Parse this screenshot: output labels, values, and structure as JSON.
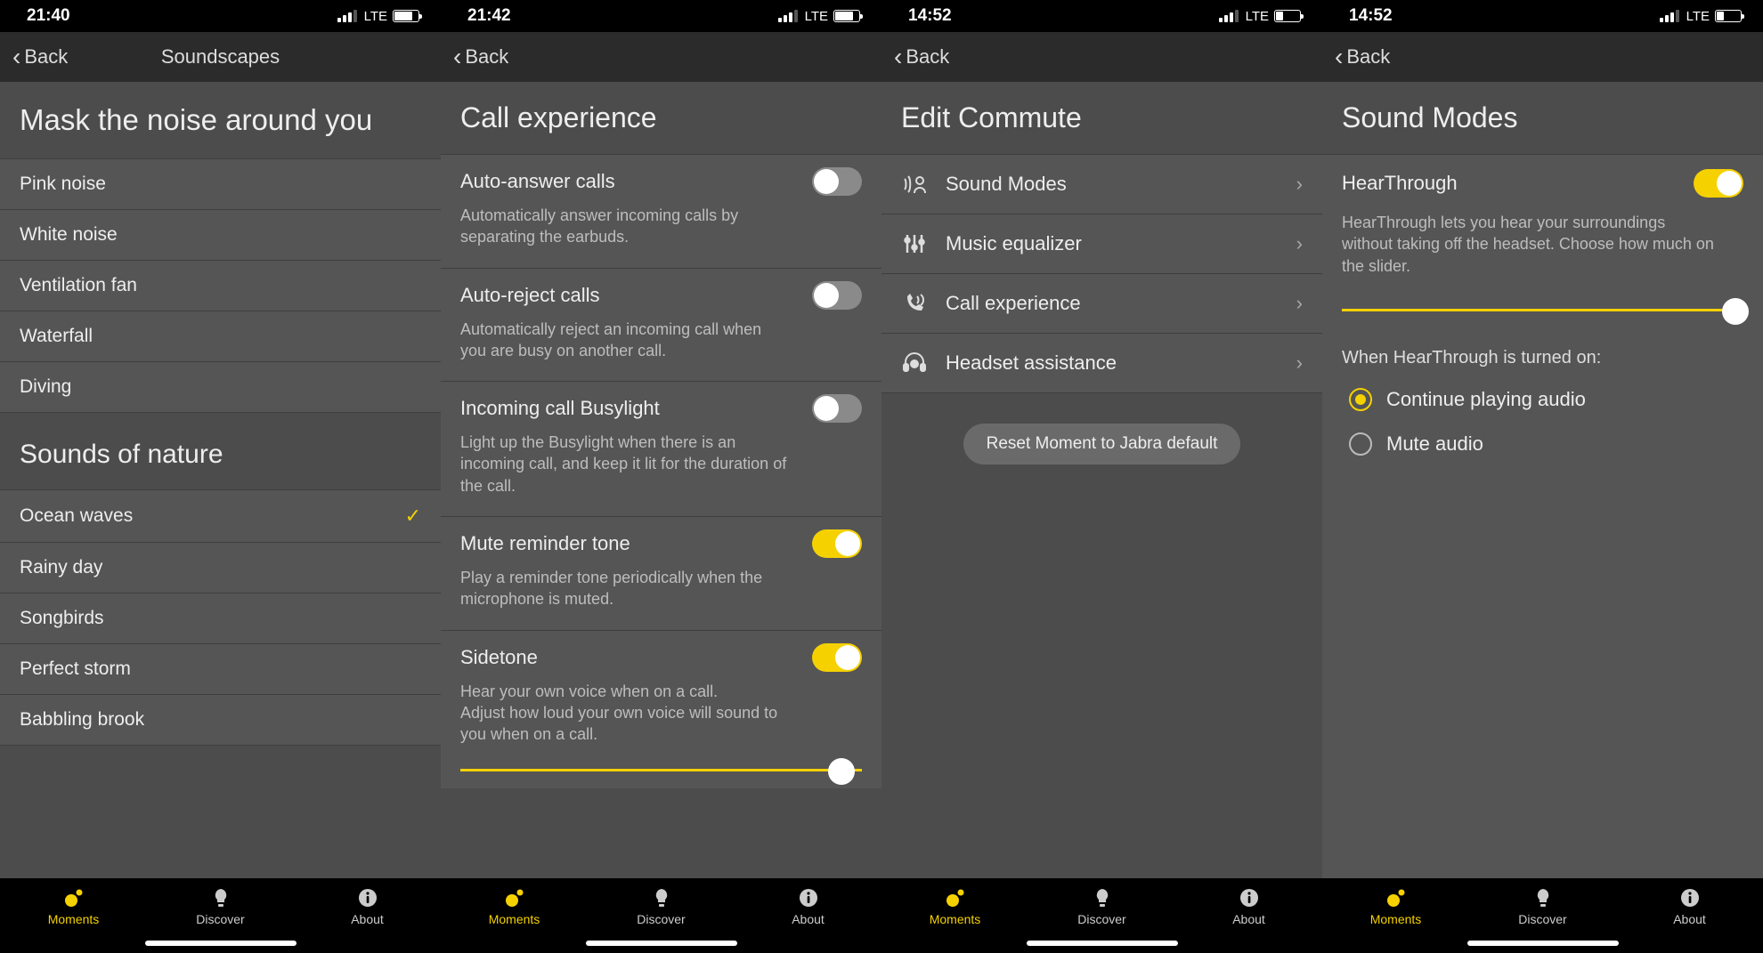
{
  "colors": {
    "accent": "#f5d100",
    "bg": "#4c4c4c",
    "row": "#555555"
  },
  "tabs": {
    "moments": "Moments",
    "discover": "Discover",
    "about": "About"
  },
  "back_label": "Back",
  "screens": [
    {
      "status": {
        "time": "21:40",
        "net": "LTE",
        "battery_pct": 72
      },
      "nav_title": "Soundscapes",
      "section1_title": "Mask the noise around you",
      "section1_items": [
        "Pink noise",
        "White noise",
        "Ventilation fan",
        "Waterfall",
        "Diving"
      ],
      "section2_title": "Sounds of nature",
      "section2_items": [
        "Ocean waves",
        "Rainy day",
        "Songbirds",
        "Perfect storm",
        "Babbling brook"
      ],
      "selected_item": "Ocean waves"
    },
    {
      "status": {
        "time": "21:42",
        "net": "LTE",
        "battery_pct": 72
      },
      "page_title": "Call experience",
      "settings": [
        {
          "label": "Auto-answer calls",
          "desc": "Automatically answer incoming calls by separating the earbuds.",
          "on": false
        },
        {
          "label": "Auto-reject calls",
          "desc": "Automatically reject an incoming call when you are busy on another call.",
          "on": false
        },
        {
          "label": "Incoming call Busylight",
          "desc": "Light up the Busylight when there is an incoming call, and keep it lit for the duration of the call.",
          "on": false
        },
        {
          "label": "Mute reminder tone",
          "desc": "Play a reminder tone periodically when the microphone is muted.",
          "on": true
        },
        {
          "label": "Sidetone",
          "desc": "Hear your own voice when on a call.\nAdjust how loud your own voice will sound to you when on a call.",
          "on": true,
          "slider": 0.95
        }
      ]
    },
    {
      "status": {
        "time": "14:52",
        "net": "LTE",
        "battery_pct": 28
      },
      "page_title": "Edit Commute",
      "nav_items": [
        {
          "icon": "sound-modes-icon",
          "label": "Sound Modes"
        },
        {
          "icon": "equalizer-icon",
          "label": "Music equalizer"
        },
        {
          "icon": "call-icon",
          "label": "Call experience"
        },
        {
          "icon": "headset-icon",
          "label": "Headset assistance"
        }
      ],
      "reset_label": "Reset Moment to Jabra default"
    },
    {
      "status": {
        "time": "14:52",
        "net": "LTE",
        "battery_pct": 28
      },
      "page_title": "Sound Modes",
      "hearthrough": {
        "label": "HearThrough",
        "on": true,
        "desc": "HearThrough lets you hear your surroundings without taking off the headset. Choose how much on the slider.",
        "slider": 0.98,
        "prompt": "When HearThrough is turned on:",
        "options": [
          "Continue playing audio",
          "Mute audio"
        ],
        "selected": "Continue playing audio"
      }
    }
  ]
}
